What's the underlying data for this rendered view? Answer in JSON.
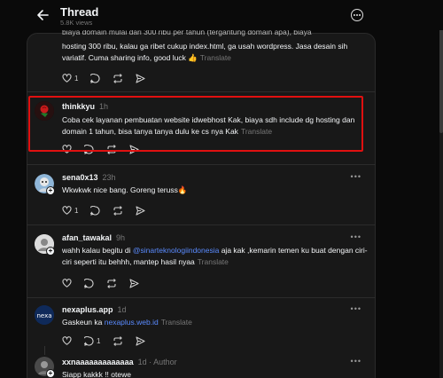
{
  "header": {
    "title": "Thread",
    "views": "5.8K views"
  },
  "posts": [
    {
      "username": "",
      "time": "",
      "body": "hosting 300 ribu, kalau ga ribet cukup index.html, ga usah wordpress. Jasa desain sih variatif. Cuma sharing info, good luck 👍",
      "body_top_partial": "biaya domain mulai dari 300 ribu per tahun (tergantung domain apa), biaya",
      "translate": "Translate",
      "likes": "1",
      "replies": ""
    },
    {
      "username": "thinkkyu",
      "time": "1h",
      "body": "Coba cek layanan pembuatan website idwebhost Kak, biaya sdh include dg hosting dan domain 1 tahun, bisa tanya tanya dulu ke cs nya Kak",
      "translate": "Translate",
      "likes": "",
      "replies": ""
    },
    {
      "username": "sena0x13",
      "time": "23h",
      "body": "Wkwkwk nice bang. Goreng teruss🔥",
      "translate": "",
      "likes": "1",
      "replies": ""
    },
    {
      "username": "afan_tawakal",
      "time": "9h",
      "body_pre": "wahh kalau begitu di ",
      "mention": "@sinarteknologiindonesia",
      "body_post": " aja kak ,kemarin temen ku buat dengan ciri-ciri seperti itu behhh, mantep hasil nyaa",
      "translate": "Translate",
      "likes": "",
      "replies": ""
    },
    {
      "username": "nexaplus.app",
      "time": "1d",
      "body_pre": "Gaskeun ka ",
      "link": "nexaplus.web.id",
      "translate": "Translate",
      "likes": "",
      "replies": "1"
    },
    {
      "username": "xxnaaaaaaaaaaaaa",
      "time": "1d",
      "author": "Author",
      "body": "Siapp kakkk !! otewe"
    }
  ],
  "colors": {
    "highlight": "#e01010",
    "mention": "#5a8bff",
    "muted": "#777777",
    "background": "#0a0a0a",
    "panel": "#181818"
  },
  "icons": [
    "back-arrow-icon",
    "more-icon",
    "heart-icon",
    "comment-icon",
    "repost-icon",
    "share-icon"
  ]
}
